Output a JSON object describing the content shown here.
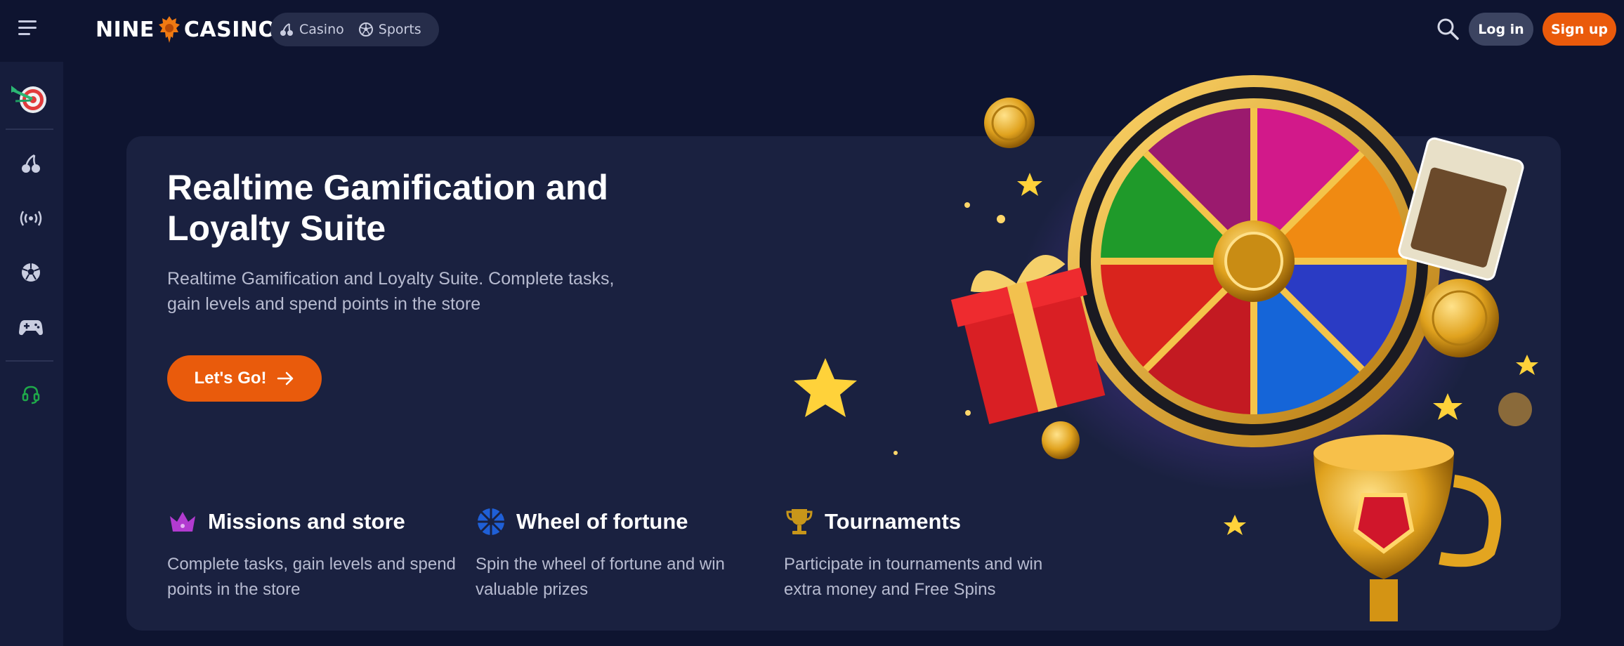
{
  "header": {
    "logo_left": "NINE",
    "logo_right": "CASINO",
    "nav": [
      {
        "label": "Casino",
        "icon": "cherry-icon"
      },
      {
        "label": "Sports",
        "icon": "soccer-ball-icon"
      }
    ],
    "login_label": "Log in",
    "signup_label": "Sign up"
  },
  "sidebar": {
    "items": [
      {
        "icon": "dartboard-promo-icon"
      },
      {
        "icon": "cherry-icon"
      },
      {
        "icon": "live-broadcast-icon"
      },
      {
        "icon": "soccer-ball-icon"
      },
      {
        "icon": "gamepad-icon"
      },
      {
        "icon": "headset-support-icon"
      }
    ]
  },
  "banner": {
    "title": "Realtime Gamification and Loyalty Suite",
    "description": "Realtime Gamification and Loyalty Suite. Complete tasks, gain levels and spend points in the store",
    "cta_label": "Let's Go!",
    "features": [
      {
        "icon": "crown-icon",
        "title": "Missions and store",
        "description": "Complete tasks, gain levels and spend points in the store"
      },
      {
        "icon": "fortune-wheel-icon",
        "title": "Wheel of fortune",
        "description": "Spin the wheel of fortune and win valuable prizes"
      },
      {
        "icon": "trophy-icon",
        "title": "Tournaments",
        "description": "Participate in tournaments and win extra money and Free Spins"
      }
    ]
  },
  "colors": {
    "background": "#0e1430",
    "sidebar": "#161d3c",
    "banner": "#1a2140",
    "accent": "#ea5a0b",
    "login_button": "#3c4461",
    "support_icon": "#1fa84a"
  }
}
